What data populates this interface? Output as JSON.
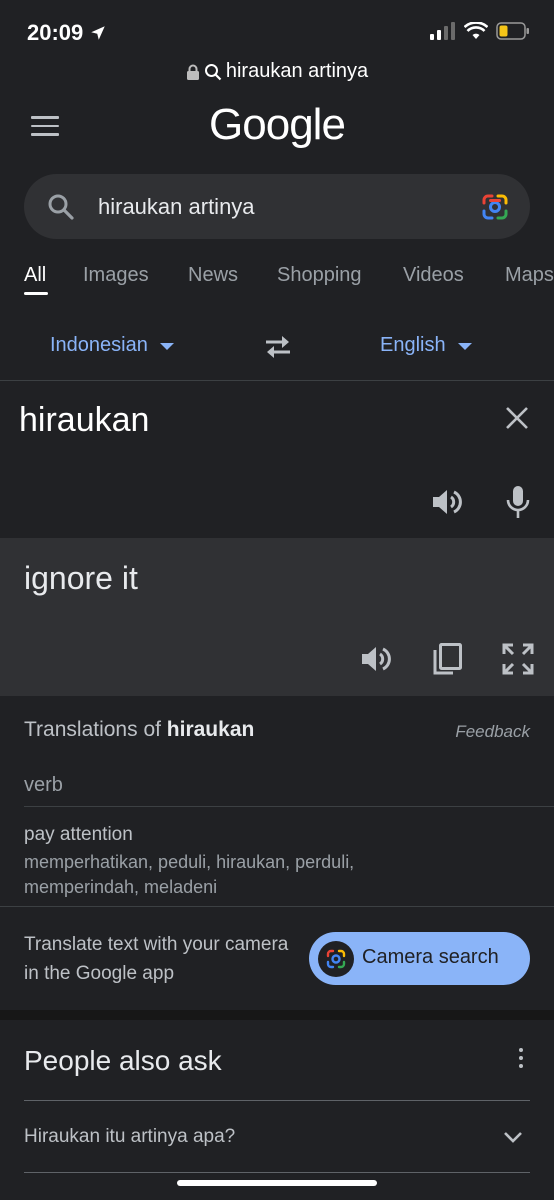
{
  "status_bar": {
    "time": "20:09",
    "icons": [
      "location-arrow-icon",
      "signal-icon",
      "wifi-icon",
      "battery-icon"
    ]
  },
  "url_bar": {
    "text": "hirauken artinya",
    "icons": [
      "lock-icon",
      "search-icon"
    ]
  },
  "header": {
    "logo": "Google",
    "menu_icon": "hamburger-menu-icon"
  },
  "search": {
    "query": "hiraukan artinya",
    "icons": [
      "search-icon",
      "google-lens-icon"
    ]
  },
  "tabs": [
    {
      "label": "All",
      "active": true
    },
    {
      "label": "Images",
      "active": false
    },
    {
      "label": "News",
      "active": false
    },
    {
      "label": "Shopping",
      "active": false
    },
    {
      "label": "Videos",
      "active": false
    },
    {
      "label": "Maps",
      "active": false
    }
  ],
  "translator": {
    "source_lang": "Indonesian",
    "target_lang": "English",
    "source_text": "hiraukan",
    "target_text": "ignore it"
  },
  "translations": {
    "heading_prefix": "Translations of ",
    "heading_word": "hiraukan",
    "feedback": "Feedback",
    "part_of_speech": "verb",
    "entries": [
      {
        "word": "pay attention",
        "synonyms": "memperhatikan, peduli, hiraukan, perduli, memperindah, meladeni"
      }
    ]
  },
  "promo": {
    "text": "Translate text with your camera in the Google app",
    "button": "Camera search"
  },
  "people_also_ask": {
    "title": "People also ask",
    "questions": [
      "Hiraukan itu artinya apa?"
    ]
  },
  "colors": {
    "background": "#202124",
    "panel": "#303134",
    "accent": "#8ab4f8"
  }
}
